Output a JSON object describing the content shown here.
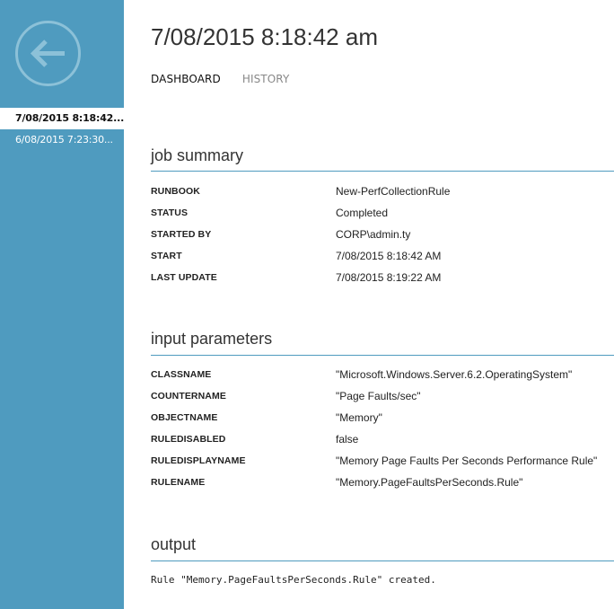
{
  "sidebar": {
    "back_label": "Back",
    "jobs": [
      {
        "label": "7/08/2015 8:18:42...",
        "selected": true
      },
      {
        "label": "6/08/2015 7:23:30...",
        "selected": false
      }
    ]
  },
  "header": {
    "title": "7/08/2015 8:18:42 am",
    "tabs": [
      {
        "label": "DASHBOARD",
        "active": true
      },
      {
        "label": "HISTORY",
        "active": false
      }
    ]
  },
  "job_summary": {
    "title": "job summary",
    "rows": [
      {
        "key": "RUNBOOK",
        "value": "New-PerfCollectionRule"
      },
      {
        "key": "STATUS",
        "value": "Completed"
      },
      {
        "key": "STARTED BY",
        "value": "CORP\\admin.ty"
      },
      {
        "key": "START",
        "value": "7/08/2015 8:18:42 AM"
      },
      {
        "key": "LAST UPDATE",
        "value": "7/08/2015 8:19:22 AM"
      }
    ]
  },
  "input_parameters": {
    "title": "input parameters",
    "rows": [
      {
        "key": "CLASSNAME",
        "value": "\"Microsoft.Windows.Server.6.2.OperatingSystem\""
      },
      {
        "key": "COUNTERNAME",
        "value": "\"Page Faults/sec\""
      },
      {
        "key": "OBJECTNAME",
        "value": "\"Memory\""
      },
      {
        "key": "RULEDISABLED",
        "value": "false"
      },
      {
        "key": "RULEDISPLAYNAME",
        "value": "\"Memory Page Faults Per Seconds Performance Rule\""
      },
      {
        "key": "RULENAME",
        "value": "\"Memory.PageFaultsPerSeconds.Rule\""
      }
    ]
  },
  "output": {
    "title": "output",
    "text": "Rule \"Memory.PageFaultsPerSeconds.Rule\" created."
  },
  "colors": {
    "accent": "#4f9bbf",
    "sidebar": "#4f9bbf",
    "back_ring": "#8cc1d8"
  },
  "icons": {
    "back": "arrow-left-circle-icon"
  }
}
